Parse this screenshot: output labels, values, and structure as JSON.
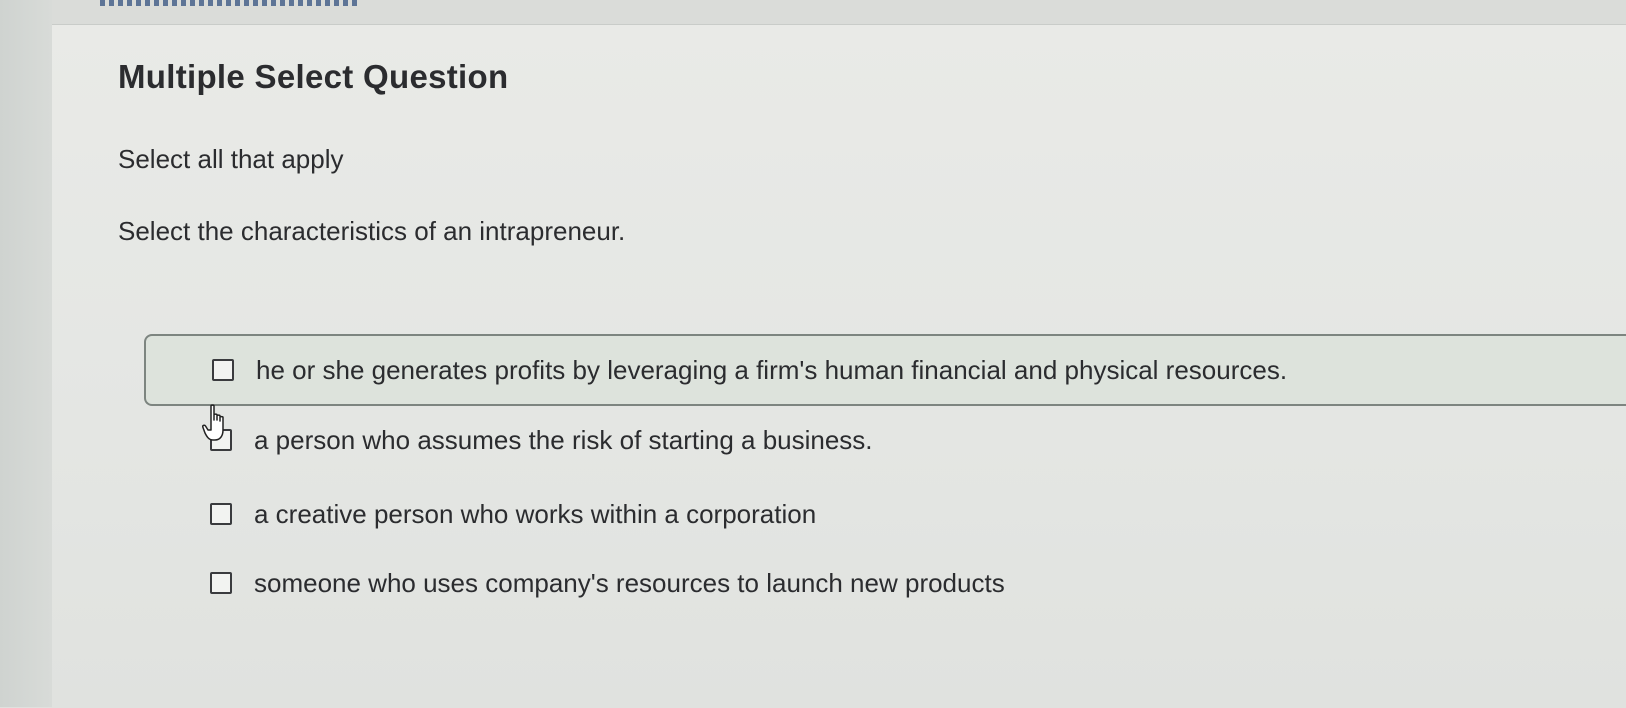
{
  "question": {
    "type_label": "Multiple Select Question",
    "instruction": "Select all that apply",
    "prompt": "Select the characteristics of an intrapreneur."
  },
  "options": [
    {
      "label": "he or she generates profits by leveraging a firm's human financial and physical resources.",
      "checked": false,
      "hovered": true
    },
    {
      "label": "a person who assumes the risk of starting a business.",
      "checked": false,
      "hovered": false
    },
    {
      "label": "a creative person who works within a corporation",
      "checked": false,
      "hovered": false
    },
    {
      "label": "someone who uses company's resources to launch new products",
      "checked": false,
      "hovered": false
    }
  ],
  "cursor": {
    "icon": "hand-pointer-icon"
  },
  "colors": {
    "background": "#e6e8e5",
    "hover_background": "#dde3dc",
    "hover_border": "#7d8580",
    "text": "#2b2c2f"
  }
}
